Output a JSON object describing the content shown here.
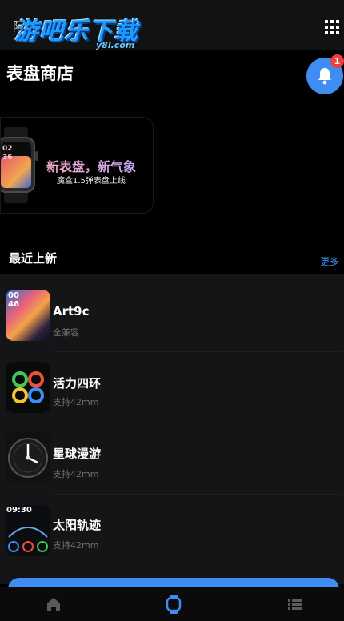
{
  "header": {
    "top_left_label": "际",
    "logo_text": "游吧乐下载",
    "logo_sub": "y8l.com",
    "menu_icon": "grid-icon"
  },
  "page": {
    "title": "表盘商店"
  },
  "notifications": {
    "icon": "bell-icon",
    "badge": "1"
  },
  "banner": {
    "headline": "新表盘，新气象",
    "subline": "魔盒1.5弹表盘上线",
    "watch_time_hour": "02",
    "watch_time_min": "36"
  },
  "section": {
    "title": "最近上新",
    "more_label": "更多"
  },
  "list": [
    {
      "name": "Art9c",
      "sub": "全兼容",
      "thumb_text_top": "00",
      "thumb_text_bottom": "46"
    },
    {
      "name": "活力四环",
      "sub": "支持42mm"
    },
    {
      "name": "星球漫游",
      "sub": "支持42mm"
    },
    {
      "name": "太阳轨迹",
      "sub": "支持42mm",
      "thumb_time": "09:30"
    }
  ],
  "tabbar": {
    "tabs": [
      "home-icon",
      "watch-icon",
      "list-icon"
    ],
    "active_color": "#3f8cf2"
  },
  "colors": {
    "accent": "#3f8cf2",
    "badge": "#e8413c",
    "background": "#000000",
    "list_bg": "#141516"
  }
}
